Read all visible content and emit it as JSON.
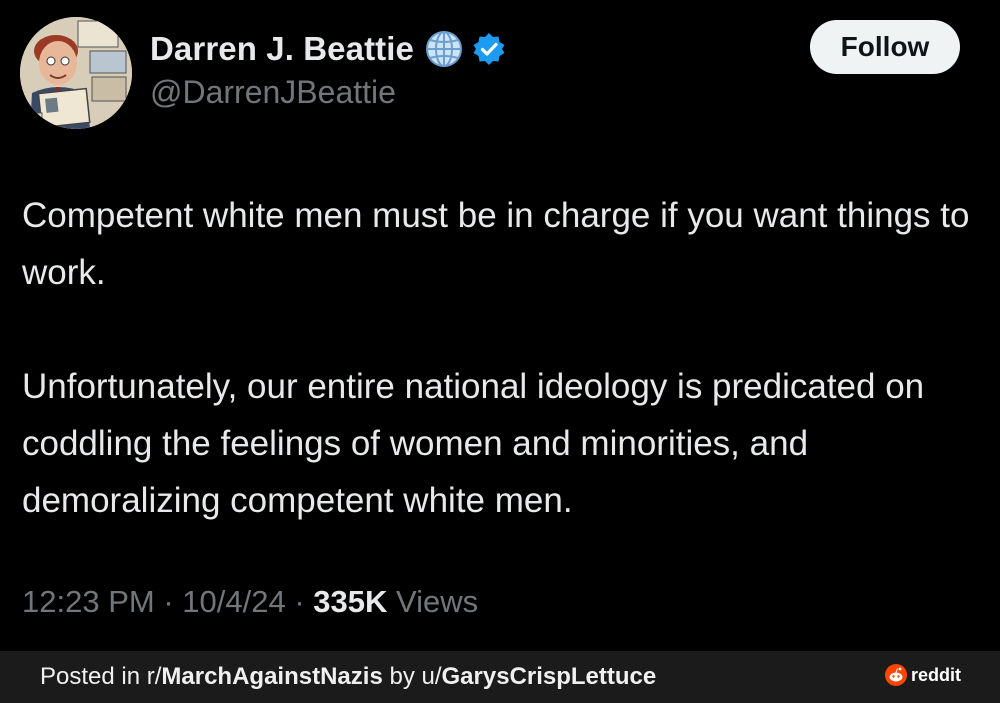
{
  "tweet": {
    "display_name": "Darren J. Beattie",
    "handle": "@DarrenJBeattie",
    "follow_label": "Follow",
    "paragraphs": [
      "Competent white men must be in charge if you want things to work.",
      "Unfortunately, our entire national ideology is predicated on coddling the feelings of women and minorities, and demoralizing competent white men."
    ],
    "time": "12:23 PM",
    "date": "10/4/24",
    "separator": "·",
    "views_count": "335K",
    "views_label": "Views",
    "icons": {
      "globe": "globe-icon",
      "verified": "verified-checkmark-icon",
      "avatar": "cartoon-avatar"
    },
    "colors": {
      "background": "#000000",
      "text": "#e7e9ea",
      "secondary_text": "#71767b",
      "verified_blue": "#1d9bf0",
      "follow_button_bg": "#eff3f4"
    }
  },
  "footer": {
    "posted_in_prefix": "Posted in r/",
    "subreddit": "MarchAgainstNazis",
    "by_prefix": " by u/",
    "username": "GarysCrispLettuce",
    "brand": "reddit",
    "colors": {
      "background": "#1b1b1b",
      "reddit_orange": "#ff4500"
    }
  }
}
